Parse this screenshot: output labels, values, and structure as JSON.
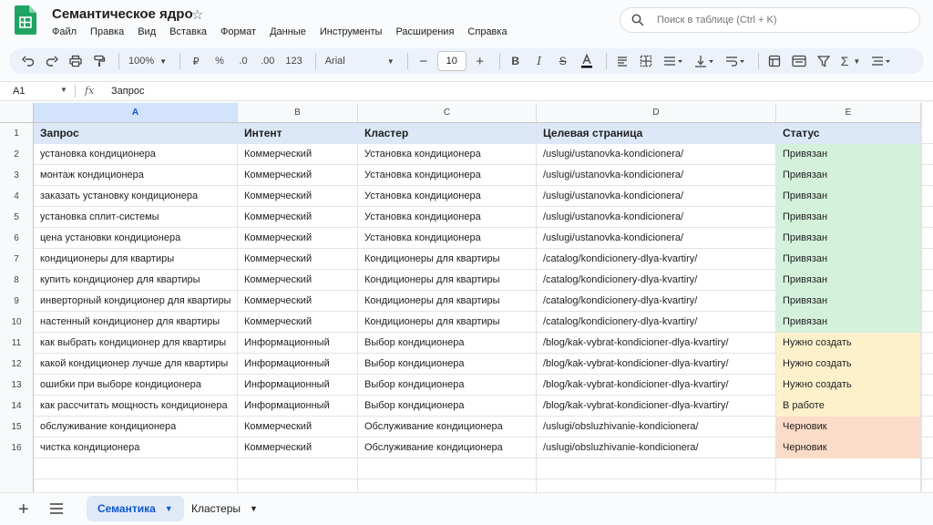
{
  "app": {
    "title": "Семантическое ядро",
    "menu": [
      "Файл",
      "Правка",
      "Вид",
      "Вставка",
      "Формат",
      "Данные",
      "Инструменты",
      "Расширения",
      "Справка"
    ],
    "search_placeholder": "Поиск в таблице (Ctrl + K)"
  },
  "toolbar": {
    "zoom": "100%",
    "currency": "₽",
    "percent": "%",
    "dec_decrease": ".0",
    "dec_increase": ".00",
    "number_format": "123",
    "font": "Arial",
    "font_size": "10"
  },
  "formula": {
    "cell_ref": "A1",
    "fx": "fx",
    "value": "Запрос"
  },
  "columns": [
    "A",
    "B",
    "C",
    "D",
    "E"
  ],
  "header": [
    "Запрос",
    "Интент",
    "Кластер",
    "Целевая страница",
    "Статус"
  ],
  "rows": [
    [
      "установка кондиционера",
      "Коммерческий",
      "Установка кондиционера",
      "/uslugi/ustanovka-kondicionera/",
      "Привязан"
    ],
    [
      "монтаж кондиционера",
      "Коммерческий",
      "Установка кондиционера",
      "/uslugi/ustanovka-kondicionera/",
      "Привязан"
    ],
    [
      "заказать установку кондиционера",
      "Коммерческий",
      "Установка кондиционера",
      "/uslugi/ustanovka-kondicionera/",
      "Привязан"
    ],
    [
      "установка сплит-системы",
      "Коммерческий",
      "Установка кондиционера",
      "/uslugi/ustanovka-kondicionera/",
      "Привязан"
    ],
    [
      "цена установки кондиционера",
      "Коммерческий",
      "Установка кондиционера",
      "/uslugi/ustanovka-kondicionera/",
      "Привязан"
    ],
    [
      "кондиционеры для квартиры",
      "Коммерческий",
      "Кондиционеры для квартиры",
      "/catalog/kondicionery-dlya-kvartiry/",
      "Привязан"
    ],
    [
      "купить кондиционер для квартиры",
      "Коммерческий",
      "Кондиционеры для квартиры",
      "/catalog/kondicionery-dlya-kvartiry/",
      "Привязан"
    ],
    [
      "инверторный кондиционер для квартиры",
      "Коммерческий",
      "Кондиционеры для квартиры",
      "/catalog/kondicionery-dlya-kvartiry/",
      "Привязан"
    ],
    [
      "настенный кондиционер для квартиры",
      "Коммерческий",
      "Кондиционеры для квартиры",
      "/catalog/kondicionery-dlya-kvartiry/",
      "Привязан"
    ],
    [
      "как выбрать кондиционер для квартиры",
      "Информационный",
      "Выбор кондиционера",
      "/blog/kak-vybrat-kondicioner-dlya-kvartiry/",
      "Нужно создать"
    ],
    [
      "какой кондиционер лучше для квартиры",
      "Информационный",
      "Выбор кондиционера",
      "/blog/kak-vybrat-kondicioner-dlya-kvartiry/",
      "Нужно создать"
    ],
    [
      "ошибки при выборе кондиционера",
      "Информационный",
      "Выбор кондиционера",
      "/blog/kak-vybrat-kondicioner-dlya-kvartiry/",
      "Нужно создать"
    ],
    [
      "как рассчитать мощность кондиционера",
      "Информационный",
      "Выбор кондиционера",
      "/blog/kak-vybrat-kondicioner-dlya-kvartiry/",
      "В работе"
    ],
    [
      "обслуживание кондиционера",
      "Коммерческий",
      "Обслуживание кондиционера",
      "/uslugi/obsluzhivanie-kondicionera/",
      "Черновик"
    ],
    [
      "чистка кондиционера",
      "Коммерческий",
      "Обслуживание кондиционера",
      "/uslugi/obsluzhivanie-kondicionera/",
      "Черновик"
    ]
  ],
  "status_colors": {
    "Привязан": "#d4f1db",
    "Нужно создать": "#fdf1cc",
    "В работе": "#fdf1cc",
    "Черновик": "#fbdcc8"
  },
  "sheets": [
    {
      "label": "Семантика",
      "active": true
    },
    {
      "label": "Кластеры",
      "active": false
    }
  ]
}
